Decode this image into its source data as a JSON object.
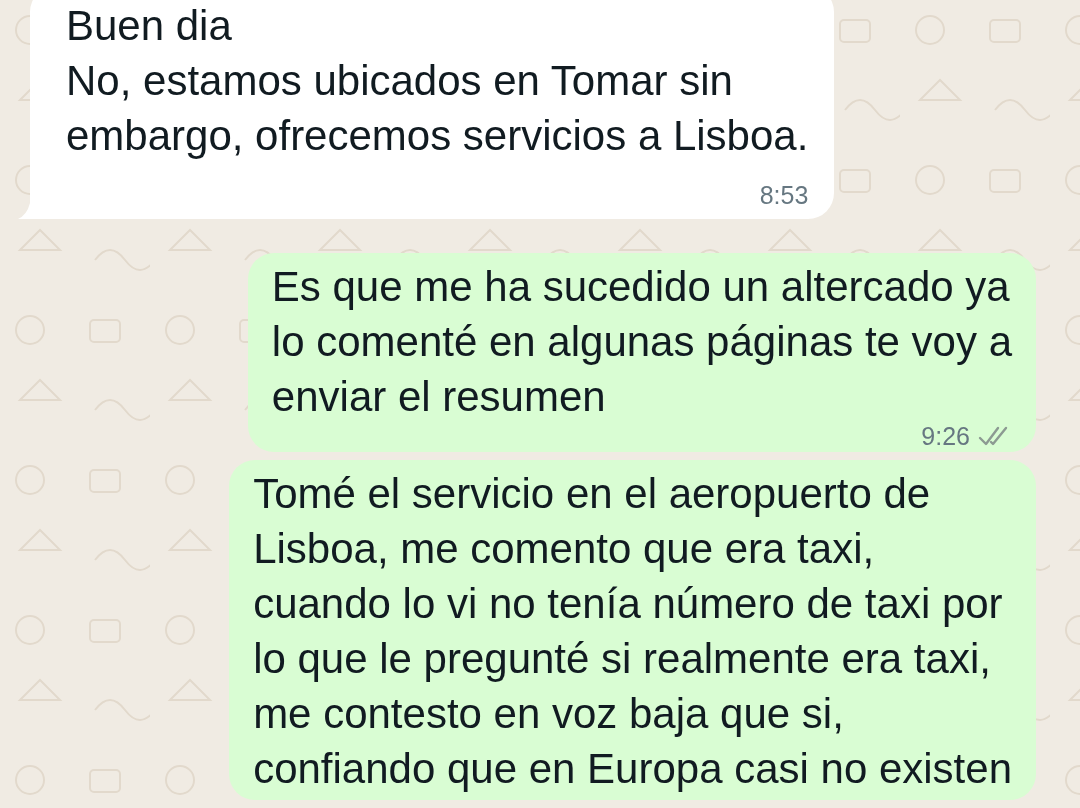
{
  "messages": [
    {
      "outgoing": false,
      "text": "Buen dia\nNo, estamos ubicados en Tomar sin\nembargo, ofrecemos servicios a Lisboa.",
      "time": "8:53",
      "tail": true
    },
    {
      "outgoing": true,
      "text": "Es que me ha sucedido un altercado ya\nlo comenté en algunas páginas te voy a\nenviar el resumen",
      "time": "9:26",
      "read": false,
      "tail": false
    },
    {
      "outgoing": true,
      "text": "Tomé el servicio en el aeropuerto de\nLisboa, me comento que era taxi,\ncuando lo vi no tenía número de taxi por\nlo que le pregunté si realmente era taxi,\nme contesto en voz baja que si,\nconfiando que en Europa casi no existen",
      "tail": false
    }
  ]
}
